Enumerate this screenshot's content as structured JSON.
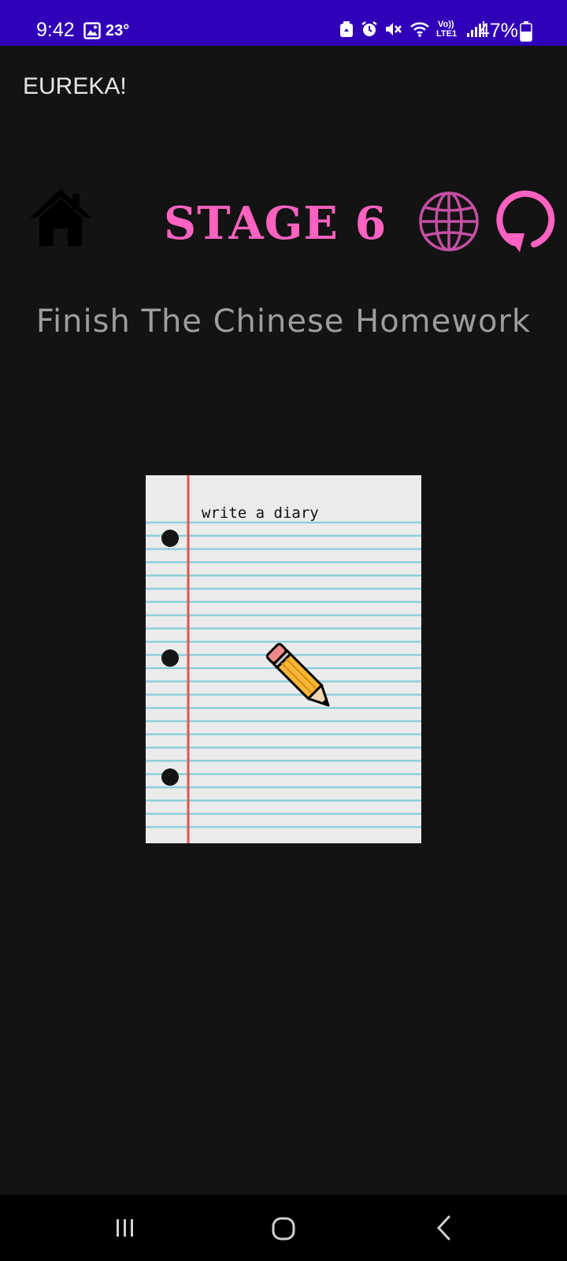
{
  "status_bar": {
    "time": "9:42",
    "temperature": "23°",
    "battery_percent": "47%",
    "network_label_top": "Vo))",
    "network_label_bottom": "LTE1",
    "background_color": "#3000b8",
    "icons": [
      "gallery-icon",
      "recycle-icon",
      "alarm-icon",
      "mute-icon",
      "wifi-icon",
      "lte-icon",
      "signal-icon",
      "battery-icon"
    ]
  },
  "app": {
    "title": "EUREKA!"
  },
  "stage": {
    "label": "STAGE 6",
    "accent_color": "#ff62c0",
    "icons": [
      "home-icon",
      "globe-icon",
      "restart-icon"
    ]
  },
  "level": {
    "title": "Finish The Chinese Homework"
  },
  "notebook": {
    "caption": "write a diary",
    "icons": [
      "pencil-icon"
    ]
  },
  "nav_bar": {
    "icons": [
      "recents-icon",
      "home-circle-icon",
      "back-icon"
    ]
  }
}
